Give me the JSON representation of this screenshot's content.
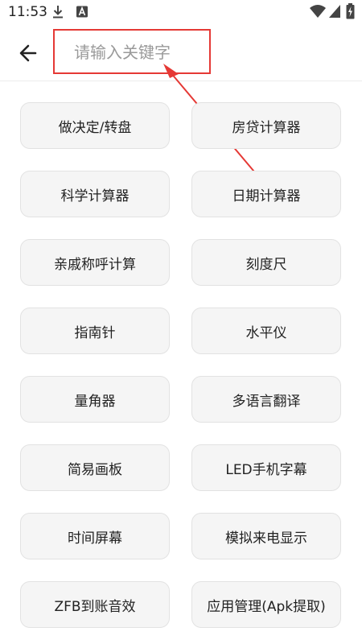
{
  "status_bar": {
    "time": "11:53"
  },
  "header": {
    "search_placeholder": "请输入关键字"
  },
  "tools": [
    {
      "label": "做决定/转盘"
    },
    {
      "label": "房贷计算器"
    },
    {
      "label": "科学计算器"
    },
    {
      "label": "日期计算器"
    },
    {
      "label": "亲戚称呼计算"
    },
    {
      "label": "刻度尺"
    },
    {
      "label": "指南针"
    },
    {
      "label": "水平仪"
    },
    {
      "label": "量角器"
    },
    {
      "label": "多语言翻译"
    },
    {
      "label": "简易画板"
    },
    {
      "label": "LED手机字幕"
    },
    {
      "label": "时间屏幕"
    },
    {
      "label": "模拟来电显示"
    },
    {
      "label": "ZFB到账音效"
    },
    {
      "label": "应用管理(Apk提取)"
    }
  ],
  "annotation_color": "#e53935",
  "icons": [
    "download-icon",
    "font-app-icon",
    "wifi-icon",
    "cellular-signal-icon",
    "battery-charging-icon",
    "back-arrow-icon"
  ]
}
